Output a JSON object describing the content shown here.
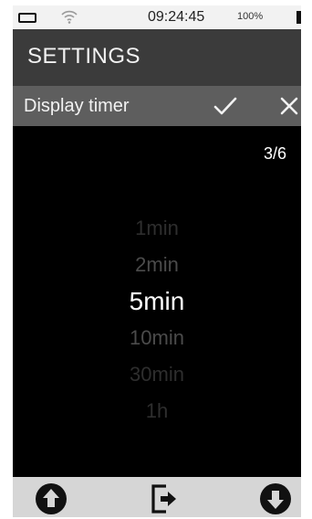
{
  "status_bar": {
    "time": "09:24:45",
    "battery_percent": "100%",
    "battery_icon": "battery-icon",
    "wifi_icon": "wifi-icon"
  },
  "screen": {
    "title": "SETTINGS"
  },
  "header": {
    "label": "Display timer",
    "confirm_icon": "checkmark-icon",
    "close_icon": "close-icon"
  },
  "picker": {
    "page_indicator": "3/6",
    "options": [
      "1min",
      "2min",
      "5min",
      "10min",
      "30min",
      "1h"
    ],
    "selected_index": 2
  },
  "footer": {
    "up_icon": "arrow-up-circle-icon",
    "exit_icon": "exit-door-icon",
    "down_icon": "arrow-down-circle-icon"
  },
  "colors": {
    "title_bar": "#3b3b3b",
    "header_bar": "#5e5e5e",
    "content_bg": "#000000",
    "footer_bg": "#d6d6d6",
    "selected_text": "#ffffff",
    "dim_text": "#2e2e2e"
  }
}
